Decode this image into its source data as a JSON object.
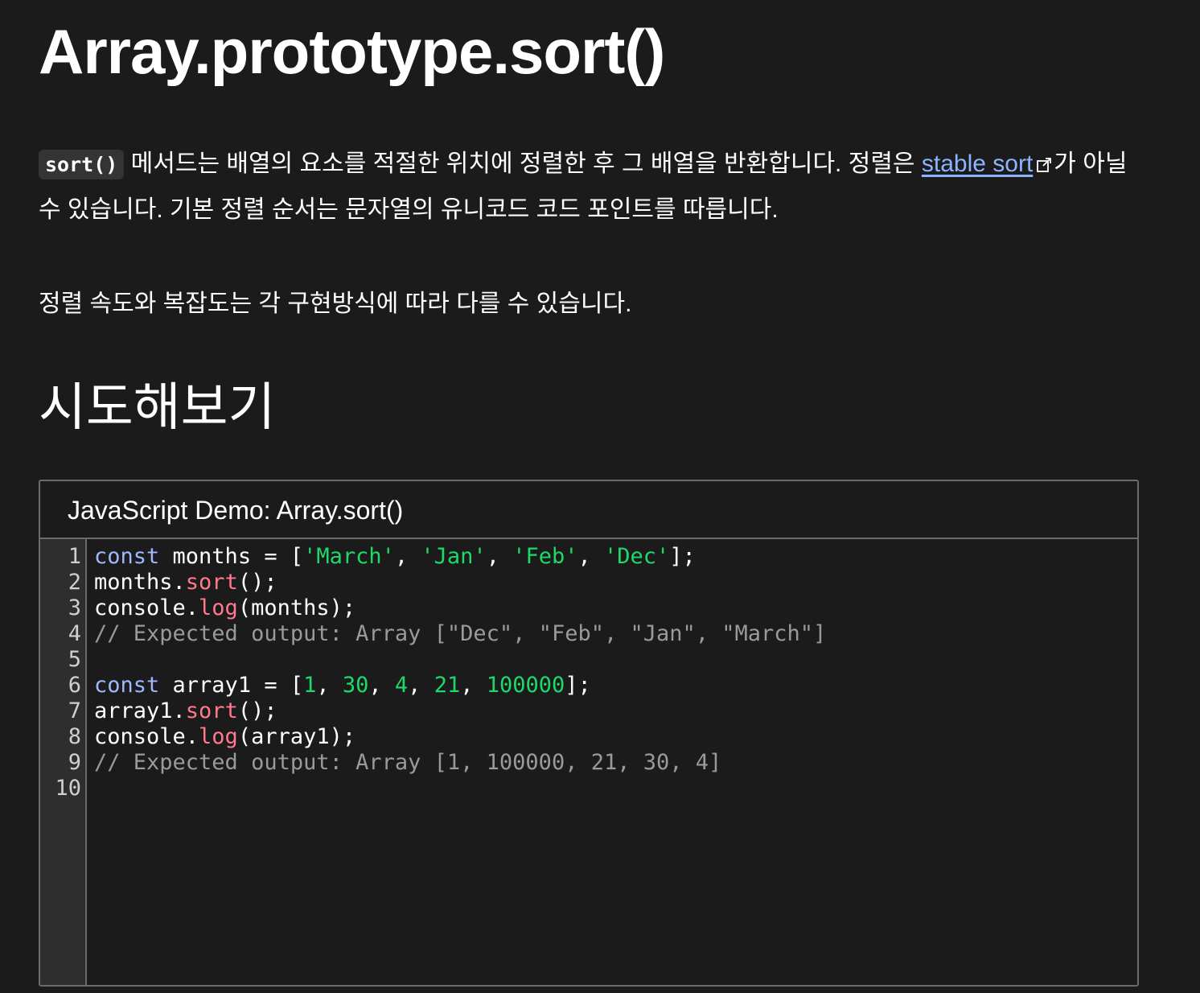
{
  "page": {
    "title": "Array.prototype.sort()",
    "intro": {
      "code": "sort()",
      "text_before_link": " 메서드는 배열의 요소를 적절한 위치에 정렬한 후 그 배열을 반환합니다. 정렬은 ",
      "link_text": "stable sort",
      "link_icon": "external-link-icon",
      "text_after_link": "가 아닐 수 있습니다. 기본 정렬 순서는 문자열의 유니코드 코드 포인트를 따릅니다."
    },
    "perf_note": "정렬 속도와 복잡도는 각 구현방식에 따라 다를 수 있습니다.",
    "try_heading": "시도해보기"
  },
  "demo": {
    "header": "JavaScript Demo: Array.sort()",
    "line_numbers": [
      "1",
      "2",
      "3",
      "4",
      "5",
      "6",
      "7",
      "8",
      "9",
      "10"
    ],
    "lines": [
      [
        [
          "keyword",
          "const"
        ],
        [
          "plain",
          " months = ["
        ],
        [
          "string",
          "'March'"
        ],
        [
          "plain",
          ", "
        ],
        [
          "string",
          "'Jan'"
        ],
        [
          "plain",
          ", "
        ],
        [
          "string",
          "'Feb'"
        ],
        [
          "plain",
          ", "
        ],
        [
          "string",
          "'Dec'"
        ],
        [
          "plain",
          "];"
        ]
      ],
      [
        [
          "plain",
          "months."
        ],
        [
          "method",
          "sort"
        ],
        [
          "plain",
          "();"
        ]
      ],
      [
        [
          "plain",
          "console."
        ],
        [
          "method",
          "log"
        ],
        [
          "plain",
          "(months);"
        ]
      ],
      [
        [
          "comment",
          "// Expected output: Array [\"Dec\", \"Feb\", \"Jan\", \"March\"]"
        ]
      ],
      [],
      [
        [
          "keyword",
          "const"
        ],
        [
          "plain",
          " array1 = ["
        ],
        [
          "number",
          "1"
        ],
        [
          "plain",
          ", "
        ],
        [
          "number",
          "30"
        ],
        [
          "plain",
          ", "
        ],
        [
          "number",
          "4"
        ],
        [
          "plain",
          ", "
        ],
        [
          "number",
          "21"
        ],
        [
          "plain",
          ", "
        ],
        [
          "number",
          "100000"
        ],
        [
          "plain",
          "];"
        ]
      ],
      [
        [
          "plain",
          "array1."
        ],
        [
          "method",
          "sort"
        ],
        [
          "plain",
          "();"
        ]
      ],
      [
        [
          "plain",
          "console."
        ],
        [
          "method",
          "log"
        ],
        [
          "plain",
          "(array1);"
        ]
      ],
      [
        [
          "comment",
          "// Expected output: Array [1, 100000, 21, 30, 4]"
        ]
      ],
      []
    ]
  },
  "colors": {
    "background": "#1b1b1b",
    "link": "#8cb4ff",
    "keyword": "#9fb7ff",
    "string": "#1fd86a",
    "method": "#ff7a8a",
    "comment": "#9a9a9a"
  }
}
